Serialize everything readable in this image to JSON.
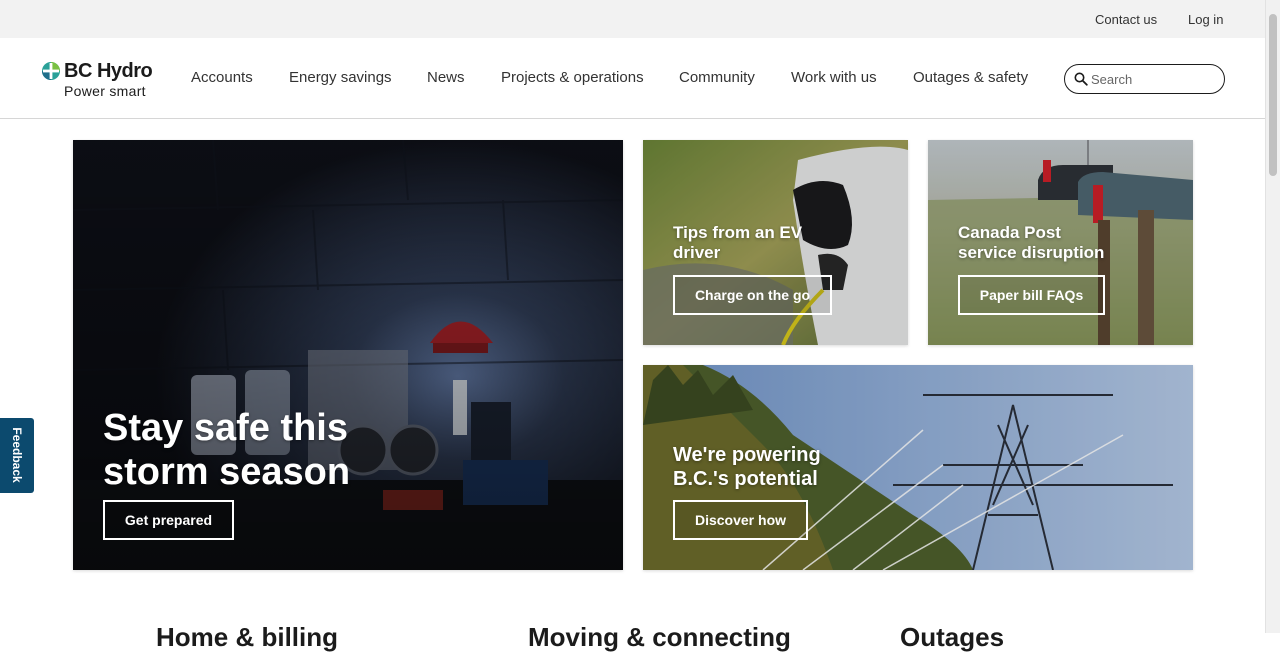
{
  "utility": {
    "contact": "Contact us",
    "login": "Log in"
  },
  "brand": {
    "name": "BC Hydro",
    "tagline": "Power smart",
    "accent": "#2aa198",
    "accent2": "#7ac143"
  },
  "nav": {
    "accounts": "Accounts",
    "energy_savings": "Energy savings",
    "news": "News",
    "projects": "Projects & operations",
    "community": "Community",
    "work": "Work with us",
    "outages": "Outages & safety"
  },
  "search": {
    "placeholder": "Search",
    "value": "",
    "icon": "search-icon"
  },
  "feedback": {
    "label": "Feedback",
    "color": "#0c4a6e"
  },
  "cards": {
    "storm": {
      "title": "Stay safe this storm season",
      "button": "Get prepared"
    },
    "ev": {
      "title": "Tips from an EV driver",
      "button": "Charge on the go"
    },
    "post": {
      "title": "Canada Post service disruption",
      "button": "Paper bill FAQs"
    },
    "power": {
      "title": "We're powering B.C.'s potential",
      "button": "Discover how"
    }
  },
  "sections": {
    "col1": "Home & billing",
    "col2": "Moving & connecting",
    "col3": "Outages"
  }
}
